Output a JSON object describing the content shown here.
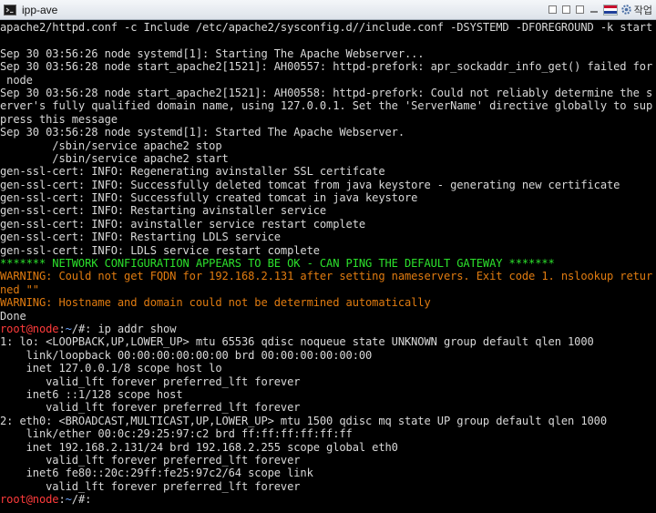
{
  "window": {
    "title": "ipp-ave",
    "work_label": "작업",
    "icons": [
      "terminal-icon",
      "square-icon",
      "square-icon",
      "square-icon",
      "minimize-icon",
      "flag-icon",
      "gear-icon"
    ]
  },
  "colors": {
    "default_text": "#d8d8d8",
    "green": "#2ce02c",
    "orange": "#e07b10",
    "prompt_red": "#ff3b3b",
    "prompt_blue": "#6ba6ff",
    "background": "#000000"
  },
  "terminal": {
    "lines": [
      {
        "segments": [
          {
            "t": "apache2/httpd.conf -c Include /etc/apache2/sysconfig.d//include.conf -DSYSTEMD -DFOREGROUND -k start",
            "c": ""
          }
        ]
      },
      {
        "segments": [
          {
            "t": "",
            "c": ""
          }
        ]
      },
      {
        "segments": [
          {
            "t": "Sep 30 03:56:26 node systemd[1]: Starting The Apache Webserver...",
            "c": ""
          }
        ]
      },
      {
        "segments": [
          {
            "t": "Sep 30 03:56:28 node start_apache2[1521]: AH00557: httpd-prefork: apr_sockaddr_info_get() failed for",
            "c": ""
          }
        ]
      },
      {
        "segments": [
          {
            "t": " node",
            "c": ""
          }
        ]
      },
      {
        "segments": [
          {
            "t": "Sep 30 03:56:28 node start_apache2[1521]: AH00558: httpd-prefork: Could not reliably determine the s",
            "c": ""
          }
        ]
      },
      {
        "segments": [
          {
            "t": "erver's fully qualified domain name, using 127.0.0.1. Set the 'ServerName' directive globally to sup",
            "c": ""
          }
        ]
      },
      {
        "segments": [
          {
            "t": "press this message",
            "c": ""
          }
        ]
      },
      {
        "segments": [
          {
            "t": "Sep 30 03:56:28 node systemd[1]: Started The Apache Webserver.",
            "c": ""
          }
        ]
      },
      {
        "segments": [
          {
            "t": "        /sbin/service apache2 stop",
            "c": ""
          }
        ]
      },
      {
        "segments": [
          {
            "t": "        /sbin/service apache2 start",
            "c": ""
          }
        ]
      },
      {
        "segments": [
          {
            "t": "gen-ssl-cert: INFO: Regenerating avinstaller SSL certifcate",
            "c": ""
          }
        ]
      },
      {
        "segments": [
          {
            "t": "gen-ssl-cert: INFO: Successfully deleted tomcat from java keystore - generating new certificate",
            "c": ""
          }
        ]
      },
      {
        "segments": [
          {
            "t": "gen-ssl-cert: INFO: Successfully created tomcat in java keystore",
            "c": ""
          }
        ]
      },
      {
        "segments": [
          {
            "t": "gen-ssl-cert: INFO: Restarting avinstaller service",
            "c": ""
          }
        ]
      },
      {
        "segments": [
          {
            "t": "gen-ssl-cert: INFO: avinstaller service restart complete",
            "c": ""
          }
        ]
      },
      {
        "segments": [
          {
            "t": "gen-ssl-cert: INFO: Restarting LDLS service",
            "c": ""
          }
        ]
      },
      {
        "segments": [
          {
            "t": "gen-ssl-cert: INFO: LDLS service restart complete",
            "c": ""
          }
        ]
      },
      {
        "segments": [
          {
            "t": "******* NETWORK CONFIGURATION APPEARS TO BE OK - CAN PING THE DEFAULT GATEWAY *******",
            "c": "green"
          }
        ]
      },
      {
        "segments": [
          {
            "t": "WARNING: Could not get FQDN for 192.168.2.131 after setting nameservers. Exit code 1. nslookup retur",
            "c": "orange"
          }
        ]
      },
      {
        "segments": [
          {
            "t": "ned \"\"",
            "c": "orange"
          }
        ]
      },
      {
        "segments": [
          {
            "t": "WARNING: Hostname and domain could not be determined automatically",
            "c": "orange"
          }
        ]
      },
      {
        "segments": [
          {
            "t": "Done",
            "c": ""
          }
        ]
      },
      {
        "segments": [
          {
            "t": "root@node",
            "c": "red"
          },
          {
            "t": ":",
            "c": ""
          },
          {
            "t": "~",
            "c": "blue"
          },
          {
            "t": "/#: ip addr show",
            "c": ""
          }
        ]
      },
      {
        "segments": [
          {
            "t": "1: lo: <LOOPBACK,UP,LOWER_UP> mtu 65536 qdisc noqueue state UNKNOWN group default qlen 1000",
            "c": ""
          }
        ]
      },
      {
        "segments": [
          {
            "t": "    link/loopback 00:00:00:00:00:00 brd 00:00:00:00:00:00",
            "c": ""
          }
        ]
      },
      {
        "segments": [
          {
            "t": "    inet 127.0.0.1/8 scope host lo",
            "c": ""
          }
        ]
      },
      {
        "segments": [
          {
            "t": "       valid_lft forever preferred_lft forever",
            "c": ""
          }
        ]
      },
      {
        "segments": [
          {
            "t": "    inet6 ::1/128 scope host",
            "c": ""
          }
        ]
      },
      {
        "segments": [
          {
            "t": "       valid_lft forever preferred_lft forever",
            "c": ""
          }
        ]
      },
      {
        "segments": [
          {
            "t": "2: eth0: <BROADCAST,MULTICAST,UP,LOWER_UP> mtu 1500 qdisc mq state UP group default qlen 1000",
            "c": ""
          }
        ]
      },
      {
        "segments": [
          {
            "t": "    link/ether 00:0c:29:25:97:c2 brd ff:ff:ff:ff:ff:ff",
            "c": ""
          }
        ]
      },
      {
        "segments": [
          {
            "t": "    inet 192.168.2.131/24 brd 192.168.2.255 scope global eth0",
            "c": ""
          }
        ]
      },
      {
        "segments": [
          {
            "t": "       valid_lft forever preferred_lft forever",
            "c": ""
          }
        ]
      },
      {
        "segments": [
          {
            "t": "    inet6 fe80::20c:29ff:fe25:97c2/64 scope link",
            "c": ""
          }
        ]
      },
      {
        "segments": [
          {
            "t": "       valid_lft forever preferred_lft forever",
            "c": ""
          }
        ]
      },
      {
        "segments": [
          {
            "t": "root@node",
            "c": "red"
          },
          {
            "t": ":",
            "c": ""
          },
          {
            "t": "~",
            "c": "blue"
          },
          {
            "t": "/#: ",
            "c": ""
          }
        ]
      }
    ]
  }
}
